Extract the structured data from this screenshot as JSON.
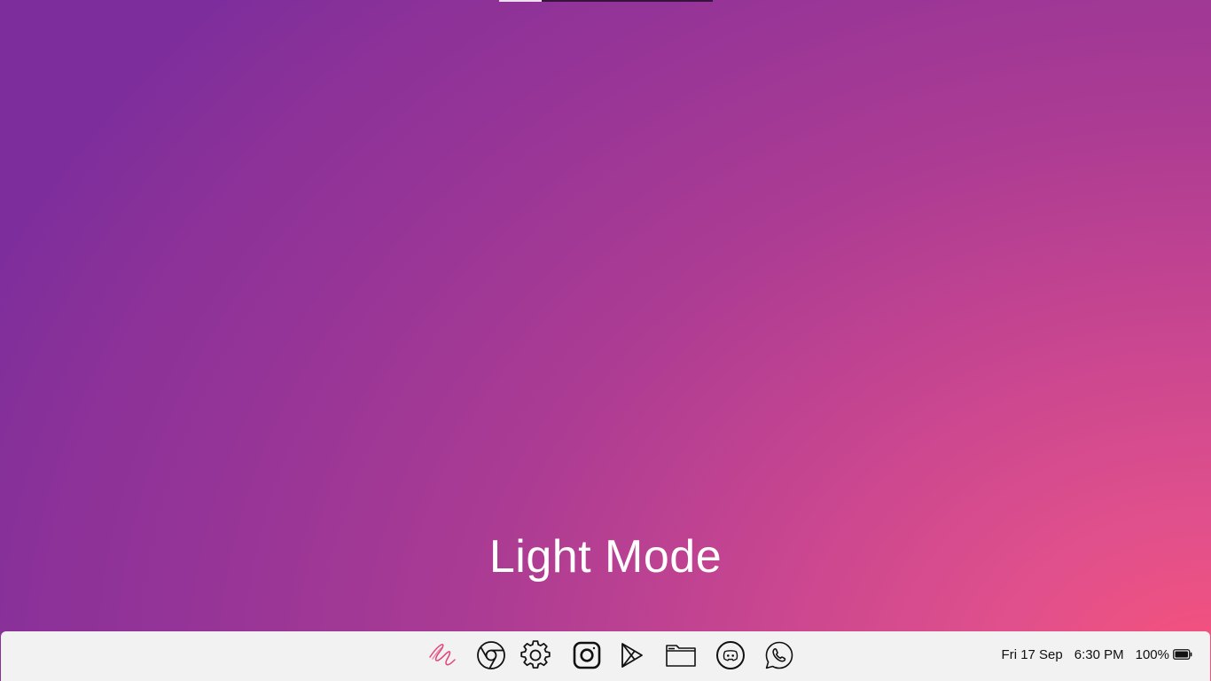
{
  "top_indicator": {
    "progress": 0.2
  },
  "wallpaper": {
    "colors": {
      "top_left": "#7e2e9c",
      "middle": "#a83b94",
      "bottom_right": "#f8527a"
    }
  },
  "main": {
    "mode_label": "Light Mode"
  },
  "taskbar": {
    "background": "#f2f2f2",
    "apps": [
      {
        "name": "scribble-app-icon",
        "accent": "#e0457b"
      },
      {
        "name": "chrome-icon"
      },
      {
        "name": "settings-gear-icon"
      },
      {
        "name": "instagram-icon"
      },
      {
        "name": "play-store-icon"
      },
      {
        "name": "files-folder-icon"
      },
      {
        "name": "discord-icon"
      },
      {
        "name": "whatsapp-icon"
      }
    ],
    "status": {
      "date": "Fri 17 Sep",
      "time": "6:30 PM",
      "battery_percent": "100%",
      "battery_level": 1.0
    }
  }
}
